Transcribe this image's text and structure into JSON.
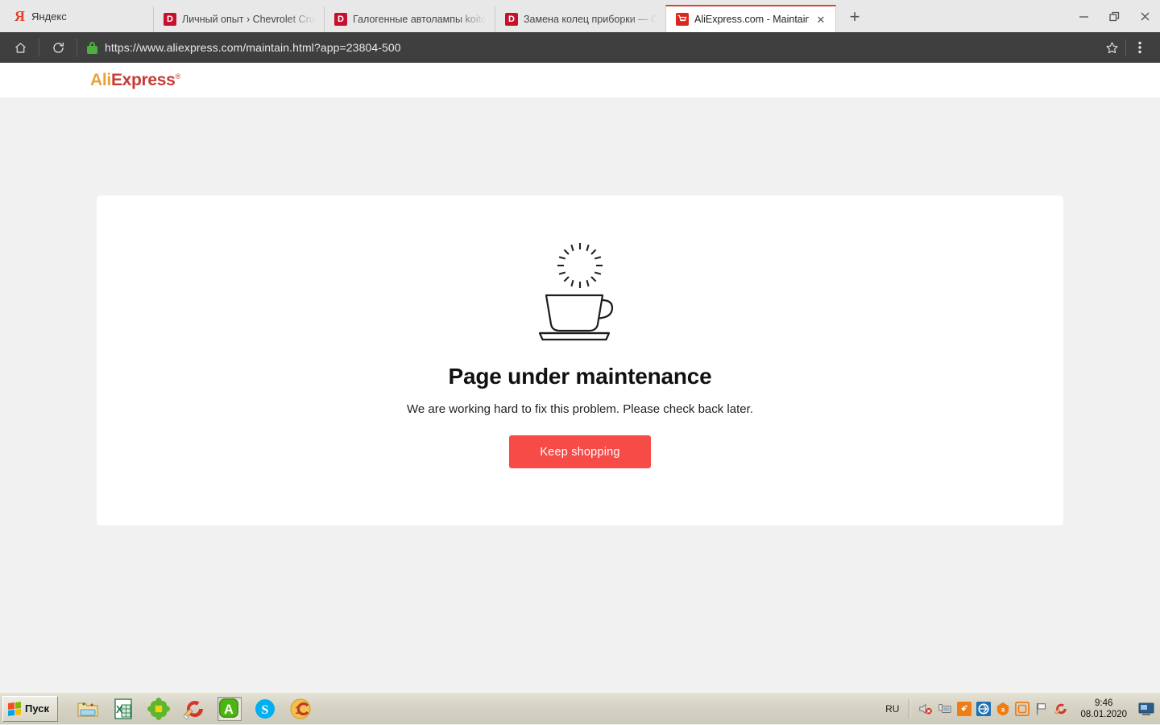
{
  "window": {
    "minimize_label": "—",
    "maximize_label": "❐",
    "close_label": "✕"
  },
  "yandex_button": {
    "logo": "Я",
    "label": "Яндекс"
  },
  "tabs": [
    {
      "favicon": "drive2-d-icon",
      "title": "Личный опыт › Chevrolet Cruze",
      "active": false
    },
    {
      "favicon": "drive2-d-icon",
      "title": "Галогенные автолампы koito w",
      "active": false
    },
    {
      "favicon": "drive2-d-icon",
      "title": "Замена колец приборки — Ch",
      "active": false
    },
    {
      "favicon": "aliexpress-cart-icon",
      "title": "AliExpress.com - Maintaining",
      "active": true,
      "close_label": "✕"
    }
  ],
  "new_tab_label": "+",
  "toolbar": {
    "home_icon": "home-icon",
    "reload_icon": "reload-icon",
    "lock_icon": "lock-icon",
    "url": "https://www.aliexpress.com/maintain.html?app=23804-500",
    "bookmark_icon": "star-icon",
    "menu_icon": "three-dots-icon"
  },
  "site": {
    "logo_part1": "Ali",
    "logo_part2": "Express",
    "logo_tm": "®",
    "headline": "Page under maintenance",
    "subline": "We are working hard to fix this problem. Please check back later.",
    "cta_label": "Keep shopping",
    "illustration": "coffee-cup-spinner-icon"
  },
  "colors": {
    "accent_red": "#f74b48",
    "logo_orange": "#e8a33d",
    "logo_red": "#c93a34",
    "page_bg": "#f1f1f1",
    "toolbar_bg": "#3f3f3f",
    "tab_active_bar": "#d94436"
  },
  "taskbar": {
    "start_label": "Пуск",
    "quick_launch": [
      {
        "name": "explorer-icon"
      },
      {
        "name": "excel-icon"
      },
      {
        "name": "icq-flower-icon"
      },
      {
        "name": "ccleaner-icon"
      },
      {
        "name": "aimp-a-icon",
        "pressed": true
      },
      {
        "name": "skype-icon"
      },
      {
        "name": "one-c-icon"
      }
    ],
    "tray": {
      "language": "RU",
      "icons": [
        "speaker-muted-icon",
        "network-monitor-icon",
        "rocket-icon",
        "teamviewer-icon",
        "avast-icon",
        "avast-shield-icon",
        "flag-icon",
        "ccleaner-tray-icon"
      ],
      "time": "9:46",
      "date": "08.01.2020",
      "show_desktop": "show-desktop-icon"
    }
  }
}
